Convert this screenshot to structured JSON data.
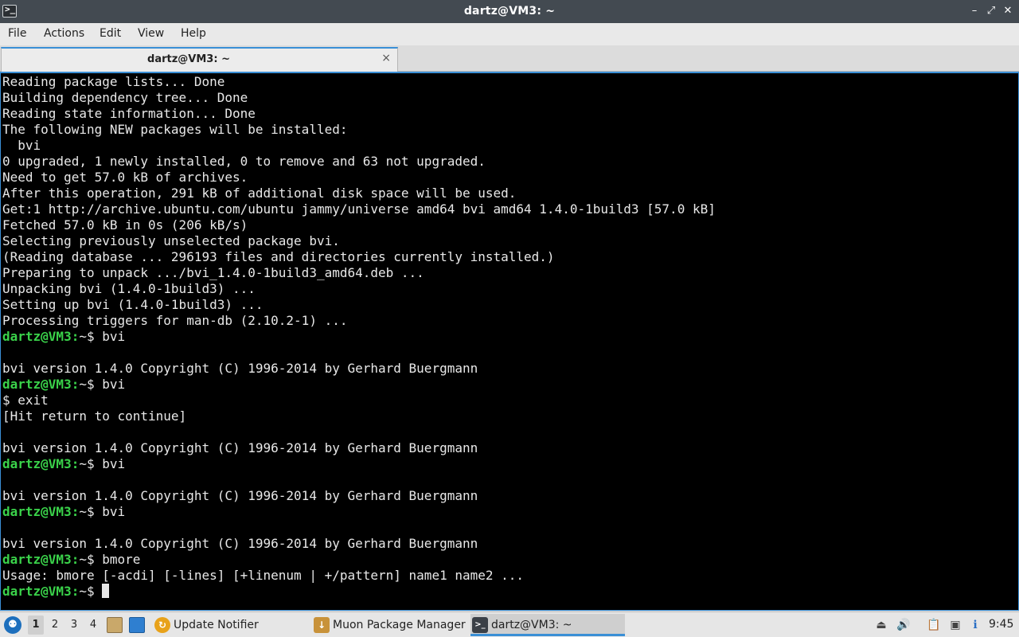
{
  "window": {
    "title": "dartz@VM3: ~",
    "app_icon": "terminal-icon",
    "controls": [
      "minimize-icon",
      "maximize-icon",
      "close-icon"
    ]
  },
  "menubar": {
    "file": "File",
    "actions": "Actions",
    "edit": "Edit",
    "view": "View",
    "help": "Help"
  },
  "tab": {
    "label": "dartz@VM3: ~",
    "close": "×"
  },
  "terminal": {
    "prompt": "dartz@VM3:",
    "path_suffix": "~$",
    "lines": [
      {
        "type": "out",
        "text": "Reading package lists... Done"
      },
      {
        "type": "out",
        "text": "Building dependency tree... Done"
      },
      {
        "type": "out",
        "text": "Reading state information... Done"
      },
      {
        "type": "out",
        "text": "The following NEW packages will be installed:"
      },
      {
        "type": "out",
        "text": "  bvi"
      },
      {
        "type": "out",
        "text": "0 upgraded, 1 newly installed, 0 to remove and 63 not upgraded."
      },
      {
        "type": "out",
        "text": "Need to get 57.0 kB of archives."
      },
      {
        "type": "out",
        "text": "After this operation, 291 kB of additional disk space will be used."
      },
      {
        "type": "out",
        "text": "Get:1 http://archive.ubuntu.com/ubuntu jammy/universe amd64 bvi amd64 1.4.0-1build3 [57.0 kB]"
      },
      {
        "type": "out",
        "text": "Fetched 57.0 kB in 0s (206 kB/s)"
      },
      {
        "type": "out",
        "text": "Selecting previously unselected package bvi."
      },
      {
        "type": "out",
        "text": "(Reading database ... 296193 files and directories currently installed.)"
      },
      {
        "type": "out",
        "text": "Preparing to unpack .../bvi_1.4.0-1build3_amd64.deb ..."
      },
      {
        "type": "out",
        "text": "Unpacking bvi (1.4.0-1build3) ..."
      },
      {
        "type": "out",
        "text": "Setting up bvi (1.4.0-1build3) ..."
      },
      {
        "type": "out",
        "text": "Processing triggers for man-db (2.10.2-1) ..."
      },
      {
        "type": "prompt",
        "text": " bvi"
      },
      {
        "type": "out",
        "text": ""
      },
      {
        "type": "out",
        "text": "bvi version 1.4.0 Copyright (C) 1996-2014 by Gerhard Buergmann"
      },
      {
        "type": "prompt",
        "text": " bvi"
      },
      {
        "type": "out",
        "text": "$ exit"
      },
      {
        "type": "out",
        "text": "[Hit return to continue]"
      },
      {
        "type": "out",
        "text": ""
      },
      {
        "type": "out",
        "text": "bvi version 1.4.0 Copyright (C) 1996-2014 by Gerhard Buergmann"
      },
      {
        "type": "prompt",
        "text": " bvi"
      },
      {
        "type": "out",
        "text": ""
      },
      {
        "type": "out",
        "text": "bvi version 1.4.0 Copyright (C) 1996-2014 by Gerhard Buergmann"
      },
      {
        "type": "prompt",
        "text": " bvi"
      },
      {
        "type": "out",
        "text": ""
      },
      {
        "type": "out",
        "text": "bvi version 1.4.0 Copyright (C) 1996-2014 by Gerhard Buergmann"
      },
      {
        "type": "prompt",
        "text": " bmore"
      },
      {
        "type": "out",
        "text": "Usage: bmore [-acdi] [-lines] [+linenum | +/pattern] name1 name2 ..."
      },
      {
        "type": "prompt",
        "text": " ",
        "cursor": true
      }
    ]
  },
  "taskbar": {
    "start_icon": "lubuntu-menu-icon",
    "workspaces": [
      "1",
      "2",
      "3",
      "4"
    ],
    "active_workspace": "1",
    "quicklaunch": [
      "file-manager-icon",
      "desktop-icon"
    ],
    "tasks": [
      {
        "label": "Update Notifier",
        "icon": "update-notifier-icon"
      },
      {
        "label": "Muon Package Manager",
        "icon": "muon-package-icon"
      },
      {
        "label": "dartz@VM3: ~",
        "icon": "terminal-icon"
      }
    ],
    "tray": [
      "removable-media-icon",
      "volume-icon",
      "clipboard-icon",
      "network-icon",
      "notification-icon"
    ],
    "clock": "9:45"
  },
  "colors": {
    "terminal_bg": "#000000",
    "terminal_fg": "#e8e8e8",
    "prompt_green": "#3ad24a",
    "accent": "#3a8fd6",
    "titlebar": "#434a51"
  }
}
